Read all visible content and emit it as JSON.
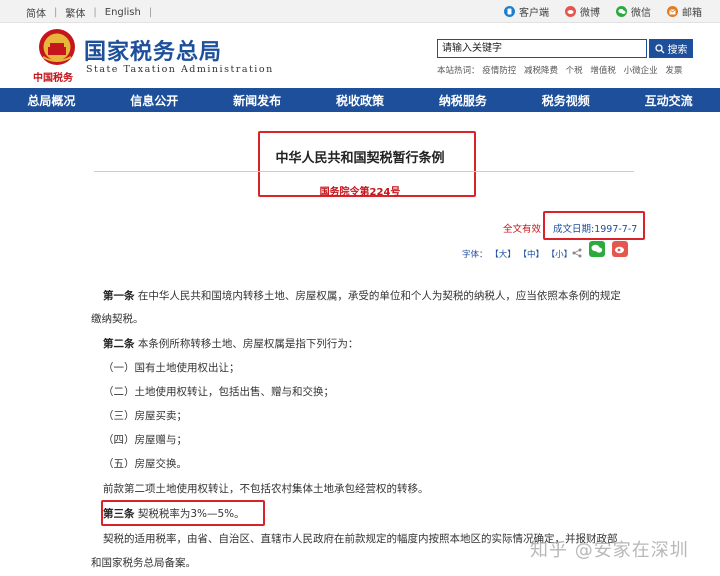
{
  "topbar": {
    "lang_simplified": "简体",
    "lang_traditional": "繁体",
    "lang_english": "English",
    "links": [
      {
        "label": "客户端",
        "icon": "mobile-client-icon",
        "color": "#1d7fd1"
      },
      {
        "label": "微博",
        "icon": "weibo-icon",
        "color": "#e4574f"
      },
      {
        "label": "微信",
        "icon": "wechat-icon",
        "color": "#2bab3d"
      },
      {
        "label": "邮箱",
        "icon": "mail-icon",
        "color": "#e07b21"
      }
    ]
  },
  "header": {
    "emblem_caption": "中国税务",
    "site_name_cn": "国家税务总局",
    "site_name_en": "State Taxation Administration",
    "search_placeholder": "请输入关键字",
    "search_button": "搜索",
    "hot_label": "本站热词：",
    "hot_words": [
      "疫情防控",
      "减税降费",
      "个税",
      "增值税",
      "小微企业",
      "发票"
    ]
  },
  "nav": [
    "总局概况",
    "信息公开",
    "新闻发布",
    "税收政策",
    "纳税服务",
    "税务视频",
    "互动交流"
  ],
  "doc": {
    "title": "中华人民共和国契税暂行条例",
    "subtitle": "国务院令第224号",
    "validity": "全文有效",
    "date_label": "成文日期:",
    "date_value": "1997-7-7",
    "font_size_label": "字体：",
    "font_large": "【大】",
    "font_medium": "【中】",
    "font_small": "【小】",
    "share_icon": "share-icon"
  },
  "content": {
    "art1_label": "第一条",
    "art1_text_line1": "在中华人民共和国境内转移土地、房屋权属，承受的单位和个人为契税的纳税人，应当依照本条例的规定",
    "art1_text_line2": "缴纳契税。",
    "art2_label": "第二条",
    "art2_text": "本条例所称转移土地、房屋权属是指下列行为：",
    "items": [
      "（一）国有土地使用权出让；",
      "（二）土地使用权转让，包括出售、赠与和交换；",
      "（三）房屋买卖；",
      "（四）房屋赠与；",
      "（五）房屋交换。"
    ],
    "note": "前款第二项土地使用权转让，不包括农村集体土地承包经营权的转移。",
    "art3_label": "第三条",
    "art3_text": "契税税率为3%—5%。",
    "art3_detail_line1": "契税的适用税率，由省、自治区、直辖市人民政府在前款规定的幅度内按照本地区的实际情况确定，并报财政部",
    "art3_detail_line2": "和国家税务总局备案。"
  },
  "watermark": "知乎 @安家在深圳",
  "colors": {
    "brand_blue": "#1d4f9a",
    "highlight_red": "#d9222a"
  }
}
